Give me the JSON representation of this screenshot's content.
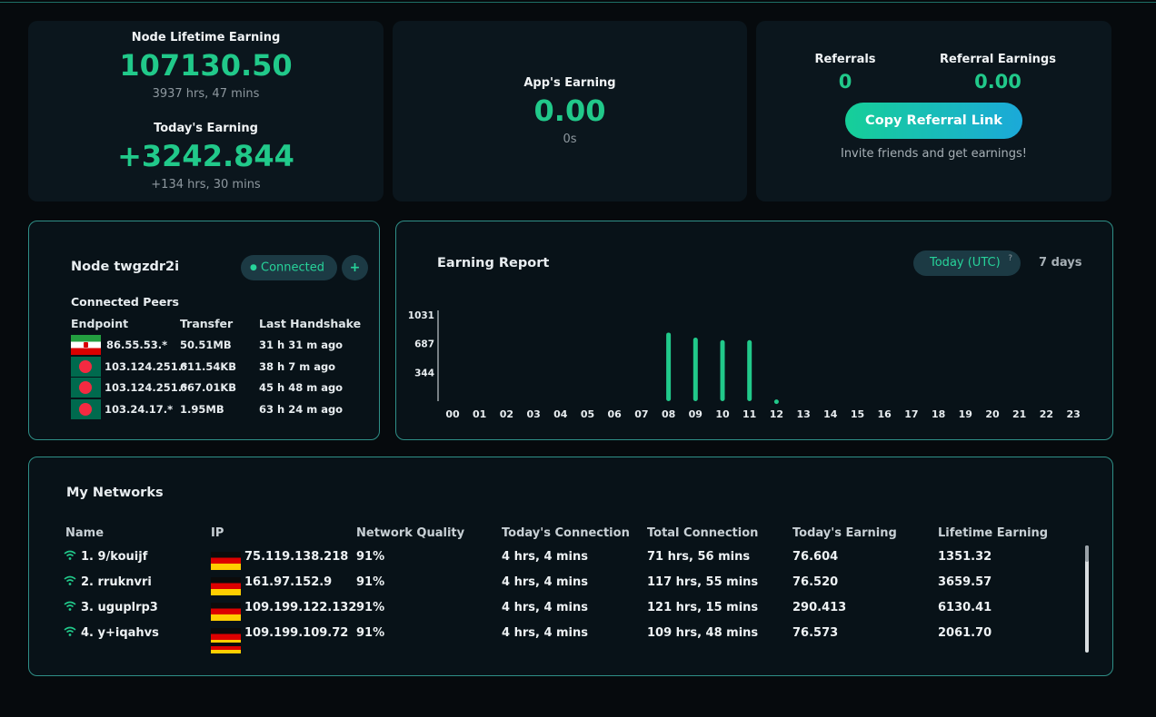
{
  "lifetime": {
    "label": "Node Lifetime Earning",
    "value": "107130.50",
    "time": "3937 hrs, 47 mins"
  },
  "today": {
    "label": "Today's Earning",
    "value": "+3242.844",
    "time": "+134 hrs, 30 mins"
  },
  "app": {
    "label": "App's Earning",
    "value": "0.00",
    "time": "0s"
  },
  "referral": {
    "referrals_label": "Referrals",
    "referrals_value": "0",
    "earnings_label": "Referral Earnings",
    "earnings_value": "0.00",
    "button_label": "Copy Referral Link",
    "invite_text": "Invite friends and get earnings!"
  },
  "node": {
    "title": "Node twgzdr2i",
    "status": "Connected",
    "add_icon": "plus-icon",
    "peers_title": "Connected Peers",
    "columns": [
      "Endpoint",
      "Transfer",
      "Last Handshake"
    ],
    "peers": [
      {
        "flag": "iran-flag",
        "endpoint": "86.55.53.*",
        "transfer": "50.51MB",
        "handshake": "31 h 31 m ago"
      },
      {
        "flag": "bangladesh-flag",
        "endpoint": "103.124.251.*",
        "transfer": "611.54KB",
        "handshake": "38 h 7 m ago"
      },
      {
        "flag": "bangladesh-flag",
        "endpoint": "103.124.251.*",
        "transfer": "667.01KB",
        "handshake": "45 h 48 m ago"
      },
      {
        "flag": "bangladesh-flag",
        "endpoint": "103.24.17.*",
        "transfer": "1.95MB",
        "handshake": "63 h 24 m ago"
      }
    ]
  },
  "report": {
    "title": "Earning Report",
    "tab_today": "Today (UTC)",
    "help_icon": "?",
    "tab_week": "7 days"
  },
  "chart_data": {
    "type": "bar",
    "categories": [
      "00",
      "01",
      "02",
      "03",
      "04",
      "05",
      "06",
      "07",
      "08",
      "09",
      "10",
      "11",
      "12",
      "13",
      "14",
      "15",
      "16",
      "17",
      "18",
      "19",
      "20",
      "21",
      "22",
      "23"
    ],
    "values": [
      0,
      0,
      0,
      0,
      0,
      0,
      0,
      0,
      820,
      760,
      730,
      730,
      20,
      0,
      0,
      0,
      0,
      0,
      0,
      0,
      0,
      0,
      0,
      0
    ],
    "yticks": [
      "1031",
      "687",
      "344"
    ],
    "ytick_values": [
      1031,
      687,
      344
    ],
    "ylim": [
      0,
      1031
    ],
    "color": "#21c98a"
  },
  "networks": {
    "title": "My Networks",
    "columns": [
      "Name",
      "IP",
      "Network Quality",
      "Today's Connection",
      "Total Connection",
      "Today's Earning",
      "Lifetime Earning"
    ],
    "rows": [
      {
        "name": "1. 9/kouijf",
        "ip": "75.119.138.218",
        "quality": "91%",
        "today": "4 hrs, 4 mins",
        "total": "71 hrs, 56 mins",
        "today_earning": "76.604",
        "lifetime": "1351.32"
      },
      {
        "name": "2. rruknvri",
        "ip": "161.97.152.9",
        "quality": "91%",
        "today": "4 hrs, 4 mins",
        "total": "117 hrs, 55 mins",
        "today_earning": "76.520",
        "lifetime": "3659.57"
      },
      {
        "name": "3. uguplrp3",
        "ip": "109.199.122.132",
        "quality": "91%",
        "today": "4 hrs, 4 mins",
        "total": "121 hrs, 15 mins",
        "today_earning": "290.413",
        "lifetime": "6130.41"
      },
      {
        "name": "4. y+iqahvs",
        "ip": "109.199.109.72",
        "quality": "91%",
        "today": "4 hrs, 4 mins",
        "total": "109 hrs, 48 mins",
        "today_earning": "76.573",
        "lifetime": "2061.70"
      }
    ]
  }
}
